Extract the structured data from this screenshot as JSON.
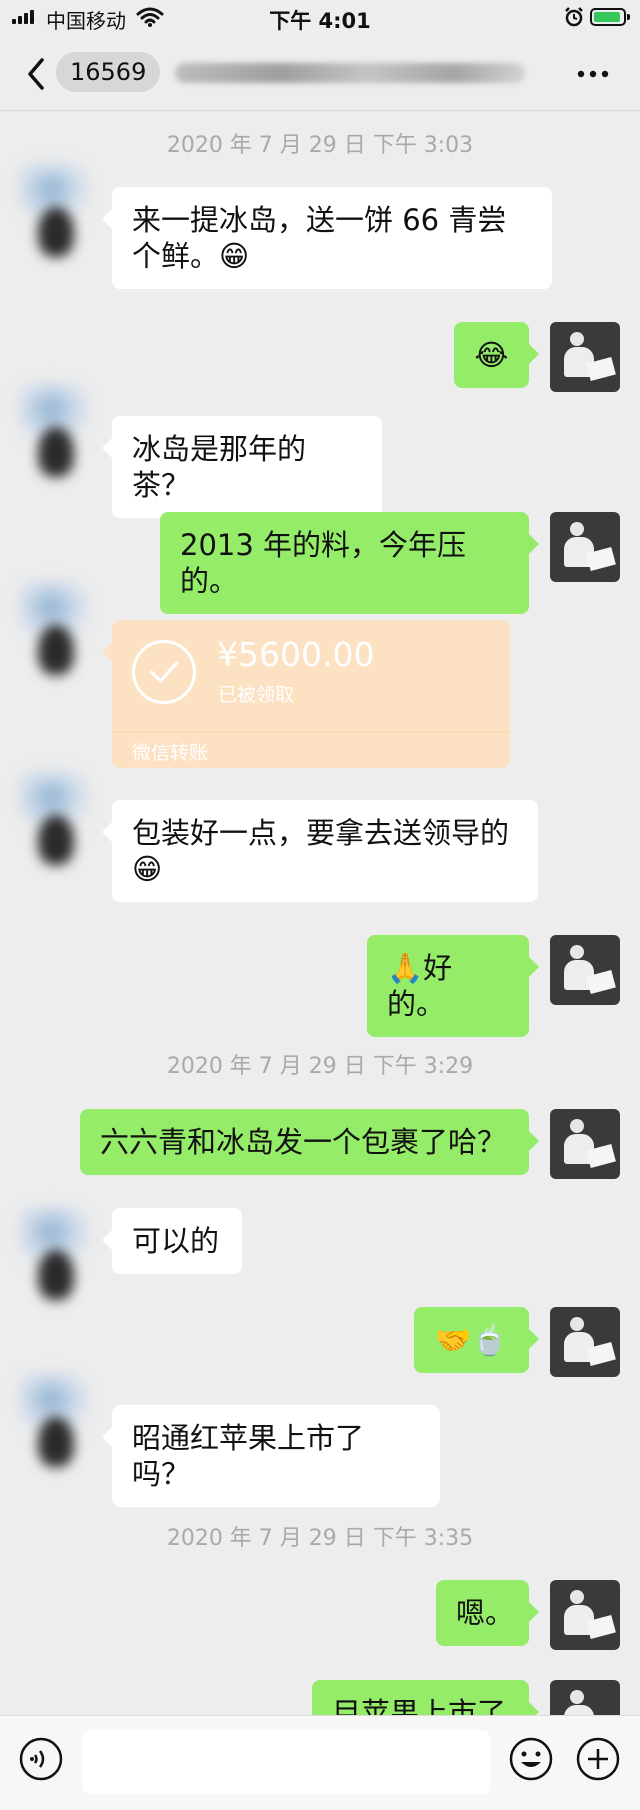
{
  "status_bar": {
    "carrier": "中国移动",
    "time": "下午 4:01"
  },
  "nav": {
    "badge_count": "16569"
  },
  "messages": [
    {
      "type": "timestamp",
      "text": "2020 年 7 月 29 日 下午 3:03"
    },
    {
      "type": "text",
      "side": "left",
      "text": "来一提冰岛，送一饼 66 青尝个鲜。😁"
    },
    {
      "type": "text",
      "side": "right",
      "text": "😂"
    },
    {
      "type": "text",
      "side": "left",
      "text": "冰岛是那年的茶？"
    },
    {
      "type": "text",
      "side": "right",
      "text": "2013 年的料，今年压的。"
    },
    {
      "type": "transfer",
      "side": "left",
      "amount": "¥5600.00",
      "status": "已被领取",
      "label": "微信转账"
    },
    {
      "type": "text",
      "side": "left",
      "text": "包装好一点，要拿去送领导的😁"
    },
    {
      "type": "text",
      "side": "right",
      "text": "🙏好的。"
    },
    {
      "type": "timestamp",
      "text": "2020 年 7 月 29 日 下午 3:29"
    },
    {
      "type": "text",
      "side": "right",
      "text": "六六青和冰岛发一个包裹了哈？"
    },
    {
      "type": "text",
      "side": "left",
      "text": "可以的"
    },
    {
      "type": "text",
      "side": "right",
      "text": "🤝🍵"
    },
    {
      "type": "text",
      "side": "left",
      "text": "昭通红苹果上市了吗？"
    },
    {
      "type": "timestamp",
      "text": "2020 年 7 月 29 日 下午 3:35"
    },
    {
      "type": "text",
      "side": "right",
      "text": "嗯。"
    },
    {
      "type": "text",
      "side": "right",
      "text": "目苹果上市了"
    }
  ],
  "icons": {
    "signal": "signal-bars-icon",
    "wifi": "wifi-icon",
    "alarm": "alarm-clock-icon",
    "battery": "battery-charging-icon",
    "back": "chevron-left-icon",
    "more": "more-dots-icon",
    "voice": "voice-icon",
    "emoji": "emoji-icon",
    "plus": "plus-circle-icon"
  },
  "colors": {
    "background": "#ededed",
    "bubble_mine": "#95ec69",
    "bubble_theirs": "#ffffff",
    "transfer_card": "#fde1c3",
    "timestamp_text": "#a9a9a9"
  }
}
